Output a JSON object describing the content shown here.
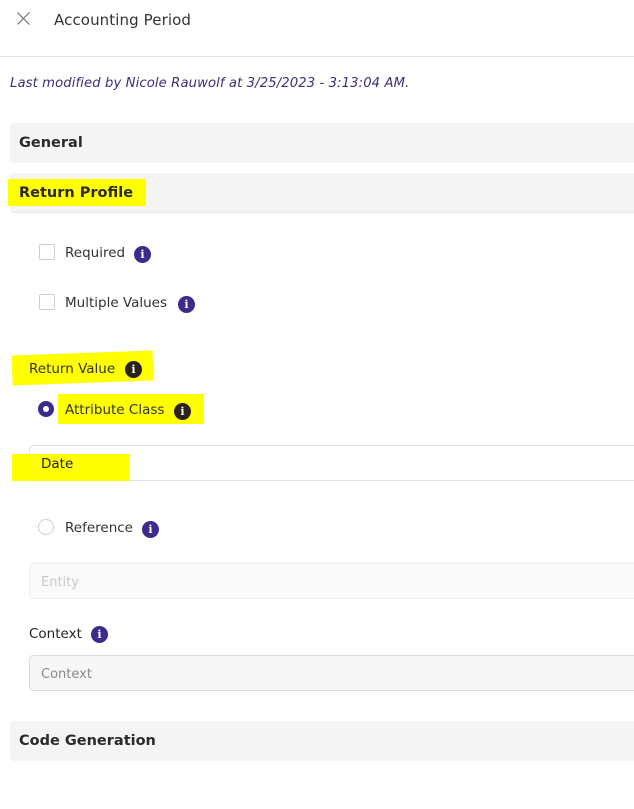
{
  "header": {
    "title": "Accounting Period"
  },
  "modified_text": "Last modified by Nicole Rauwolf at 3/25/2023 - 3:13:04 AM.",
  "sections": {
    "general": "General",
    "return_profile": "Return Profile",
    "code_generation": "Code Generation"
  },
  "options": {
    "required": {
      "label": "Required",
      "checked": false
    },
    "multiple_values": {
      "label": "Multiple Values",
      "checked": false
    }
  },
  "return_value": {
    "label": "Return Value",
    "attribute_class": {
      "label": "Attribute Class",
      "selected": true,
      "value": "Date"
    },
    "reference": {
      "label": "Reference",
      "selected": false,
      "placeholder": "Entity"
    }
  },
  "context": {
    "label": "Context",
    "placeholder": "Context"
  },
  "colors": {
    "accent": "#3e2a8c",
    "highlight": "#ffff00",
    "modified_text": "#3b2f7a"
  },
  "icons": {
    "close": "close-icon",
    "info": "info-icon"
  }
}
